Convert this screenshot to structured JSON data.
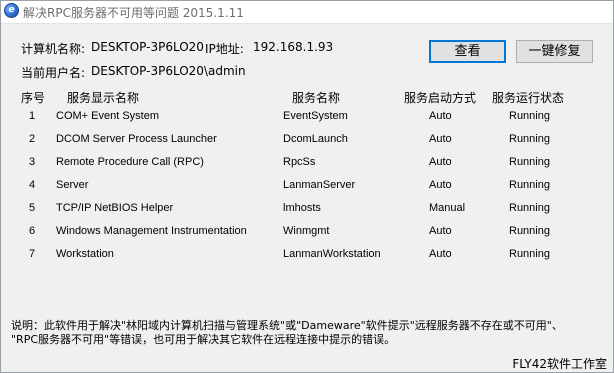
{
  "window": {
    "title": "解决RPC服务器不可用等问题 2015.1.11",
    "icon": "app-logo-icon",
    "icon_glyph": "e"
  },
  "info": {
    "computer_label": "计算机名称:",
    "computer_value": "DESKTOP-3P6LO20",
    "ip_label": "IP地址:",
    "ip_value": "192.168.1.93",
    "user_label": "当前用户名:",
    "user_value": "DESKTOP-3P6LO20\\admin"
  },
  "buttons": {
    "view": "查看",
    "repair": "一键修复"
  },
  "table": {
    "headers": [
      "序号",
      "服务显示名称",
      "服务名称",
      "服务启动方式",
      "服务运行状态"
    ],
    "rows": [
      [
        "1",
        "COM+ Event System",
        "EventSystem",
        "Auto",
        "Running"
      ],
      [
        "2",
        "DCOM Server Process Launcher",
        "DcomLaunch",
        "Auto",
        "Running"
      ],
      [
        "3",
        "Remote Procedure Call (RPC)",
        "RpcSs",
        "Auto",
        "Running"
      ],
      [
        "4",
        "Server",
        "LanmanServer",
        "Auto",
        "Running"
      ],
      [
        "5",
        "TCP/IP NetBIOS Helper",
        "lmhosts",
        "Manual",
        "Running"
      ],
      [
        "6",
        "Windows Management Instrumentation",
        "Winmgmt",
        "Auto",
        "Running"
      ],
      [
        "7",
        "Workstation",
        "LanmanWorkstation",
        "Auto",
        "Running"
      ]
    ]
  },
  "note": {
    "line1": "说明：此软件用于解决\"林阳域内计算机扫描与管理系统\"或\"Dameware\"软件提示\"远程服务器不存在或不可用\"、",
    "line2": "\"RPC服务器不可用\"等错误，也可用于解决其它软件在远程连接中提示的错误。"
  },
  "footer": "FLY42软件工作室"
}
